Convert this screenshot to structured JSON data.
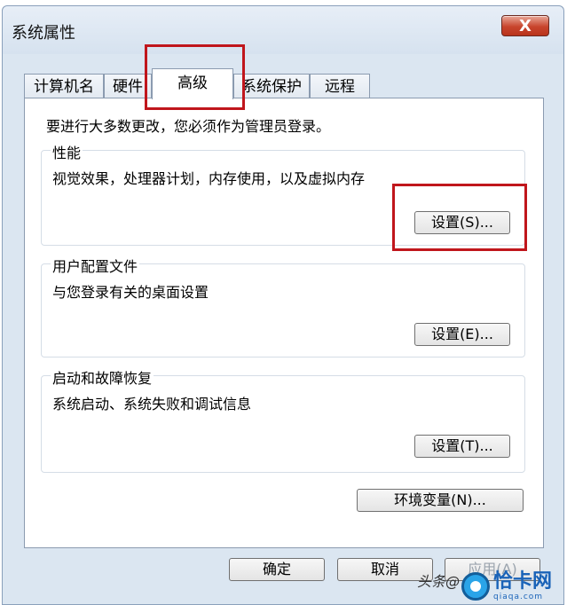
{
  "window": {
    "title": "系统属性",
    "close_label": "X"
  },
  "tabs": [
    {
      "label": "计算机名",
      "active": false
    },
    {
      "label": "硬件",
      "active": false
    },
    {
      "label": "高级",
      "active": true
    },
    {
      "label": "系统保护",
      "active": false
    },
    {
      "label": "远程",
      "active": false
    }
  ],
  "advanced": {
    "intro": "要进行大多数更改，您必须作为管理员登录。",
    "performance": {
      "title": "性能",
      "description": "视觉效果，处理器计划，内存使用，以及虚拟内存",
      "button_label": "设置(S)..."
    },
    "user_profiles": {
      "title": "用户配置文件",
      "description": "与您登录有关的桌面设置",
      "button_label": "设置(E)..."
    },
    "startup_recovery": {
      "title": "启动和故障恢复",
      "description": "系统启动、系统失败和调试信息",
      "button_label": "设置(T)..."
    },
    "env_button_label": "环境变量(N)..."
  },
  "footer": {
    "ok_label": "确定",
    "cancel_label": "取消",
    "apply_label": "应用(A)"
  },
  "overlay": {
    "watermark_text": "头条@",
    "logo_text": "恰卡网",
    "logo_sub": "qiaqa.com"
  },
  "colors": {
    "highlight": "#c0161c",
    "close_button": "#c8452d",
    "window_frame": "#dbe6f1"
  }
}
